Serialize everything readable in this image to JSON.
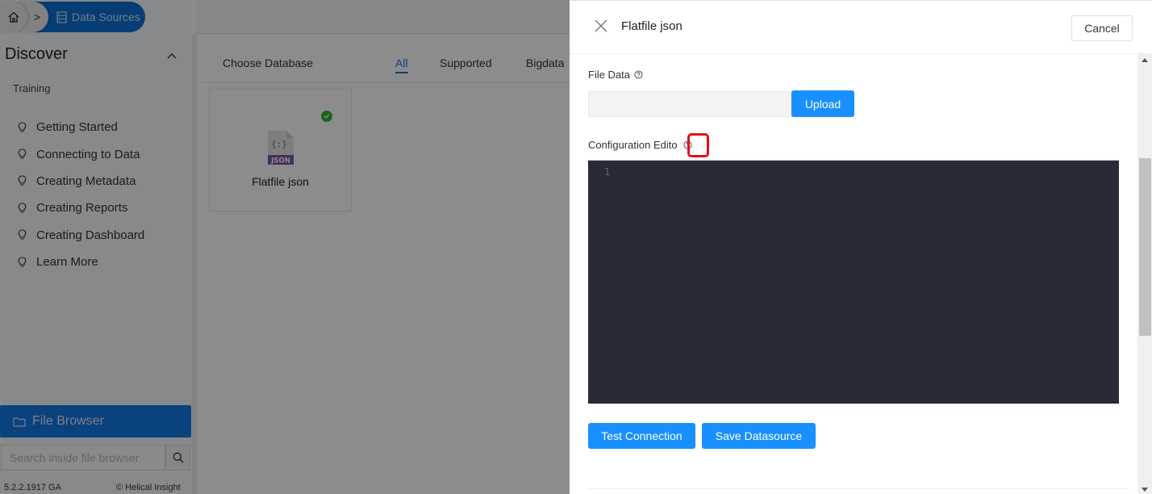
{
  "breadcrumb": {
    "home_icon": "home-icon",
    "separator": ">",
    "current": "Data Sources",
    "current_icon": "database-icon"
  },
  "sidebar": {
    "section_title": "Discover",
    "section_toggle_icon": "chevron-up-icon",
    "subsection": "Training",
    "items": [
      {
        "label": "Getting Started",
        "icon": "lightbulb-icon"
      },
      {
        "label": "Connecting to Data",
        "icon": "lightbulb-icon"
      },
      {
        "label": "Creating Metadata",
        "icon": "lightbulb-icon"
      },
      {
        "label": "Creating Reports",
        "icon": "lightbulb-icon"
      },
      {
        "label": "Creating Dashboard",
        "icon": "lightbulb-icon"
      },
      {
        "label": "Learn More",
        "icon": "lightbulb-icon"
      }
    ],
    "file_browser": {
      "label": "File Browser",
      "icon": "folder-icon"
    },
    "search": {
      "placeholder": "Search inside file browser",
      "value": "",
      "icon": "search-icon"
    },
    "version": "5.2.2.1917 GA",
    "copyright": "© Helical Insight"
  },
  "main": {
    "choose_db_label": "Choose Database",
    "tabs": [
      {
        "label": "All",
        "active": true
      },
      {
        "label": "Supported",
        "active": false
      },
      {
        "label": "Bigdata",
        "active": false
      }
    ],
    "cards": [
      {
        "label": "Flatfile json",
        "icon": "json-file-icon",
        "status": "supported",
        "status_icon": "check-circle-icon"
      }
    ]
  },
  "panel": {
    "title": "Flatfile json",
    "close_icon": "close-icon",
    "cancel_label": "Cancel",
    "file_data_label": "File Data",
    "file_data_value": "",
    "upload_label": "Upload",
    "config_editor_label": "Configuration Editor",
    "config_editor_label_visible": "Configuration Edito",
    "editor": {
      "line_numbers": [
        "1"
      ],
      "content": ""
    },
    "test_connection_label": "Test Connection",
    "save_datasource_label": "Save Datasource"
  },
  "colors": {
    "primary": "#1890ff",
    "sidebar_active": "#1378e6",
    "editor_bg": "#282b36",
    "highlight": "#e0101c",
    "success": "#3bb53b"
  }
}
